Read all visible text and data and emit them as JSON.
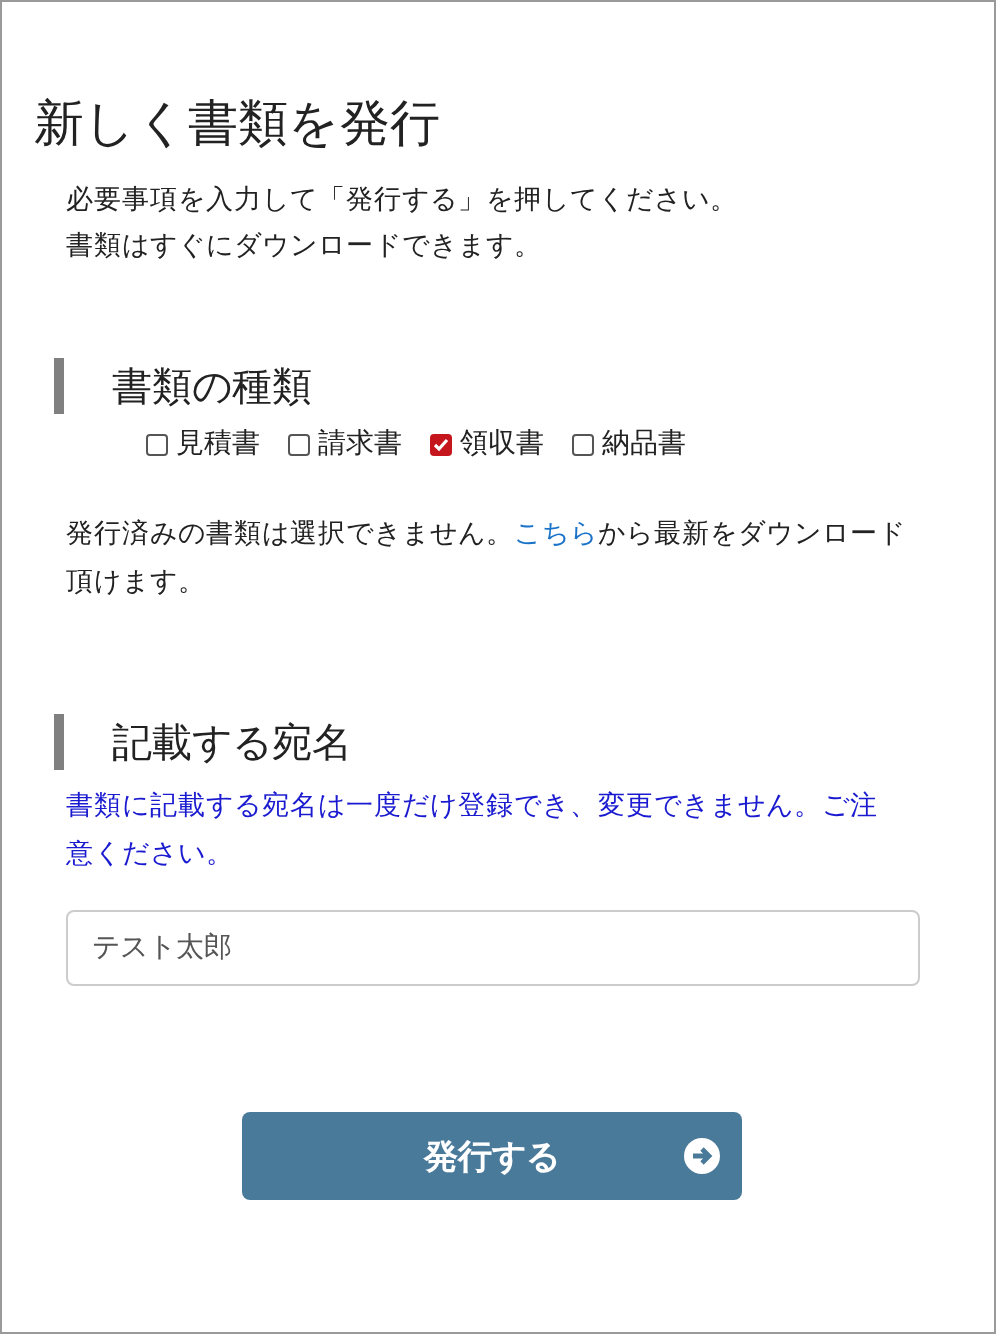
{
  "title": "新しく書類を発行",
  "intro": [
    "必要事項を入力して「発行する」を押してください。",
    "書類はすぐにダウンロードできます。"
  ],
  "document_type": {
    "heading": "書類の種類",
    "options": [
      {
        "label": "見積書",
        "checked": false
      },
      {
        "label": "請求書",
        "checked": false
      },
      {
        "label": "領収書",
        "checked": true
      },
      {
        "label": "納品書",
        "checked": false
      }
    ],
    "note": {
      "before": "発行済みの書類は選択できません。",
      "link": "こちら",
      "after": "から最新をダウンロード頂けます。"
    }
  },
  "recipient": {
    "heading": "記載する宛名",
    "warning": "書類に記載する宛名は一度だけ登録でき、変更できません。ご注意ください。",
    "value": "テスト太郎"
  },
  "submit_button": {
    "label": "発行する"
  }
}
